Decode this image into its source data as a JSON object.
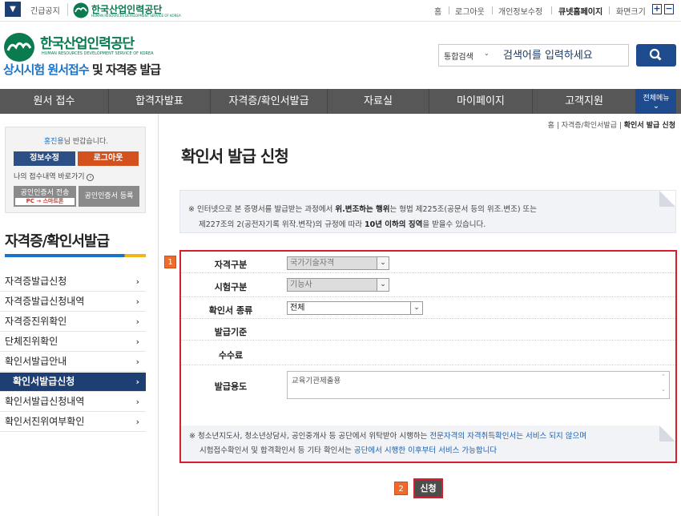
{
  "topbar": {
    "notice": "긴급공지",
    "org_name": "한국산업인력공단",
    "org_sub": "HUMAN RESOURCES DEVELOPMENT SERVICE OF KOREA",
    "links": [
      "홈",
      "로그아웃",
      "개인정보수정",
      "큐넷홈페이지",
      "화면크기"
    ]
  },
  "header": {
    "logo_name": "한국산업인력공단",
    "logo_sub": "HUMAN RESOURCES DEVELOPMENT SERVICE OF KOREA",
    "title_blue": "상시시험 원서접수",
    "title_rest": " 및 자격증 발급",
    "search_scope": "통합검색",
    "search_placeholder": "검색어를 입력하세요"
  },
  "nav": {
    "items": [
      "원서 접수",
      "합격자발표",
      "자격증/확인서발급",
      "자료실",
      "마이페이지",
      "고객지원"
    ],
    "all_menu": "전체메뉴"
  },
  "sidebar": {
    "user": "홍진용",
    "greeting": "님 반갑습니다.",
    "btn_edit": "정보수정",
    "btn_logout": "로그아웃",
    "my_link": "나의 접수내역 바로가기",
    "cert_send": "공인인증서 전송",
    "cert_send_sub": "PC → 스마트폰",
    "cert_register": "공인인증서 등록",
    "section_title": "자격증/확인서발급",
    "menu": [
      "자격증발급신청",
      "자격증발급신청내역",
      "자격증진위확인",
      "단체진위확인",
      "확인서발급안내",
      "확인서발급신청",
      "확인서발급신청내역",
      "확인서진위여부확인"
    ]
  },
  "main": {
    "breadcrumb_home": "홈",
    "breadcrumb_mid": "자격증/확인서발급",
    "breadcrumb_current": "확인서 발급 신청",
    "page_title": "확인서 발급 신청",
    "warn_line1_a": "※ 인터넷으로 본 증명서를 발급받는 과정에서 ",
    "warn_line1_b": "위.변조하는 행위",
    "warn_line1_c": "는 형법 제225조(공문서 등의 위조.변조) 또는",
    "warn_line2_a": "제227조의 2(공전자기록 위작.변작)의 규정에 따라 ",
    "warn_line2_b": "10년 이하의 징역",
    "warn_line2_c": "을 받을수 있습니다.",
    "badge1": "1",
    "badge2": "2",
    "form": {
      "cert_type_label": "자격구분",
      "cert_type_value": "국가기술자격",
      "exam_type_label": "시험구분",
      "exam_type_value": "기능사",
      "doc_kind_label": "확인서 종류",
      "doc_kind_value": "전체",
      "criteria_label": "발급기준",
      "fee_label": "수수료",
      "purpose_label": "발급용도",
      "purpose_value": "교육기관제출용"
    },
    "note_line1_a": "※ 청소년지도사, 청소년상담사, 공인중개사 등 공단에서 위탁받아 시행하는 ",
    "note_line1_b": "전문자격의 자격취득확인서는 서비스 되지 않으며",
    "note_line2_a": "시험접수확인서 및 합격확인서 등 기타 확인서는 ",
    "note_line2_b": "공단에서 시행한 이후부터 서비스 가능합니다",
    "submit_label": "신청"
  },
  "colors": {
    "brand_green": "#0a7b4f",
    "navy": "#1e3f74",
    "highlight_red": "#d61f2c",
    "badge_orange": "#f06b2b"
  }
}
